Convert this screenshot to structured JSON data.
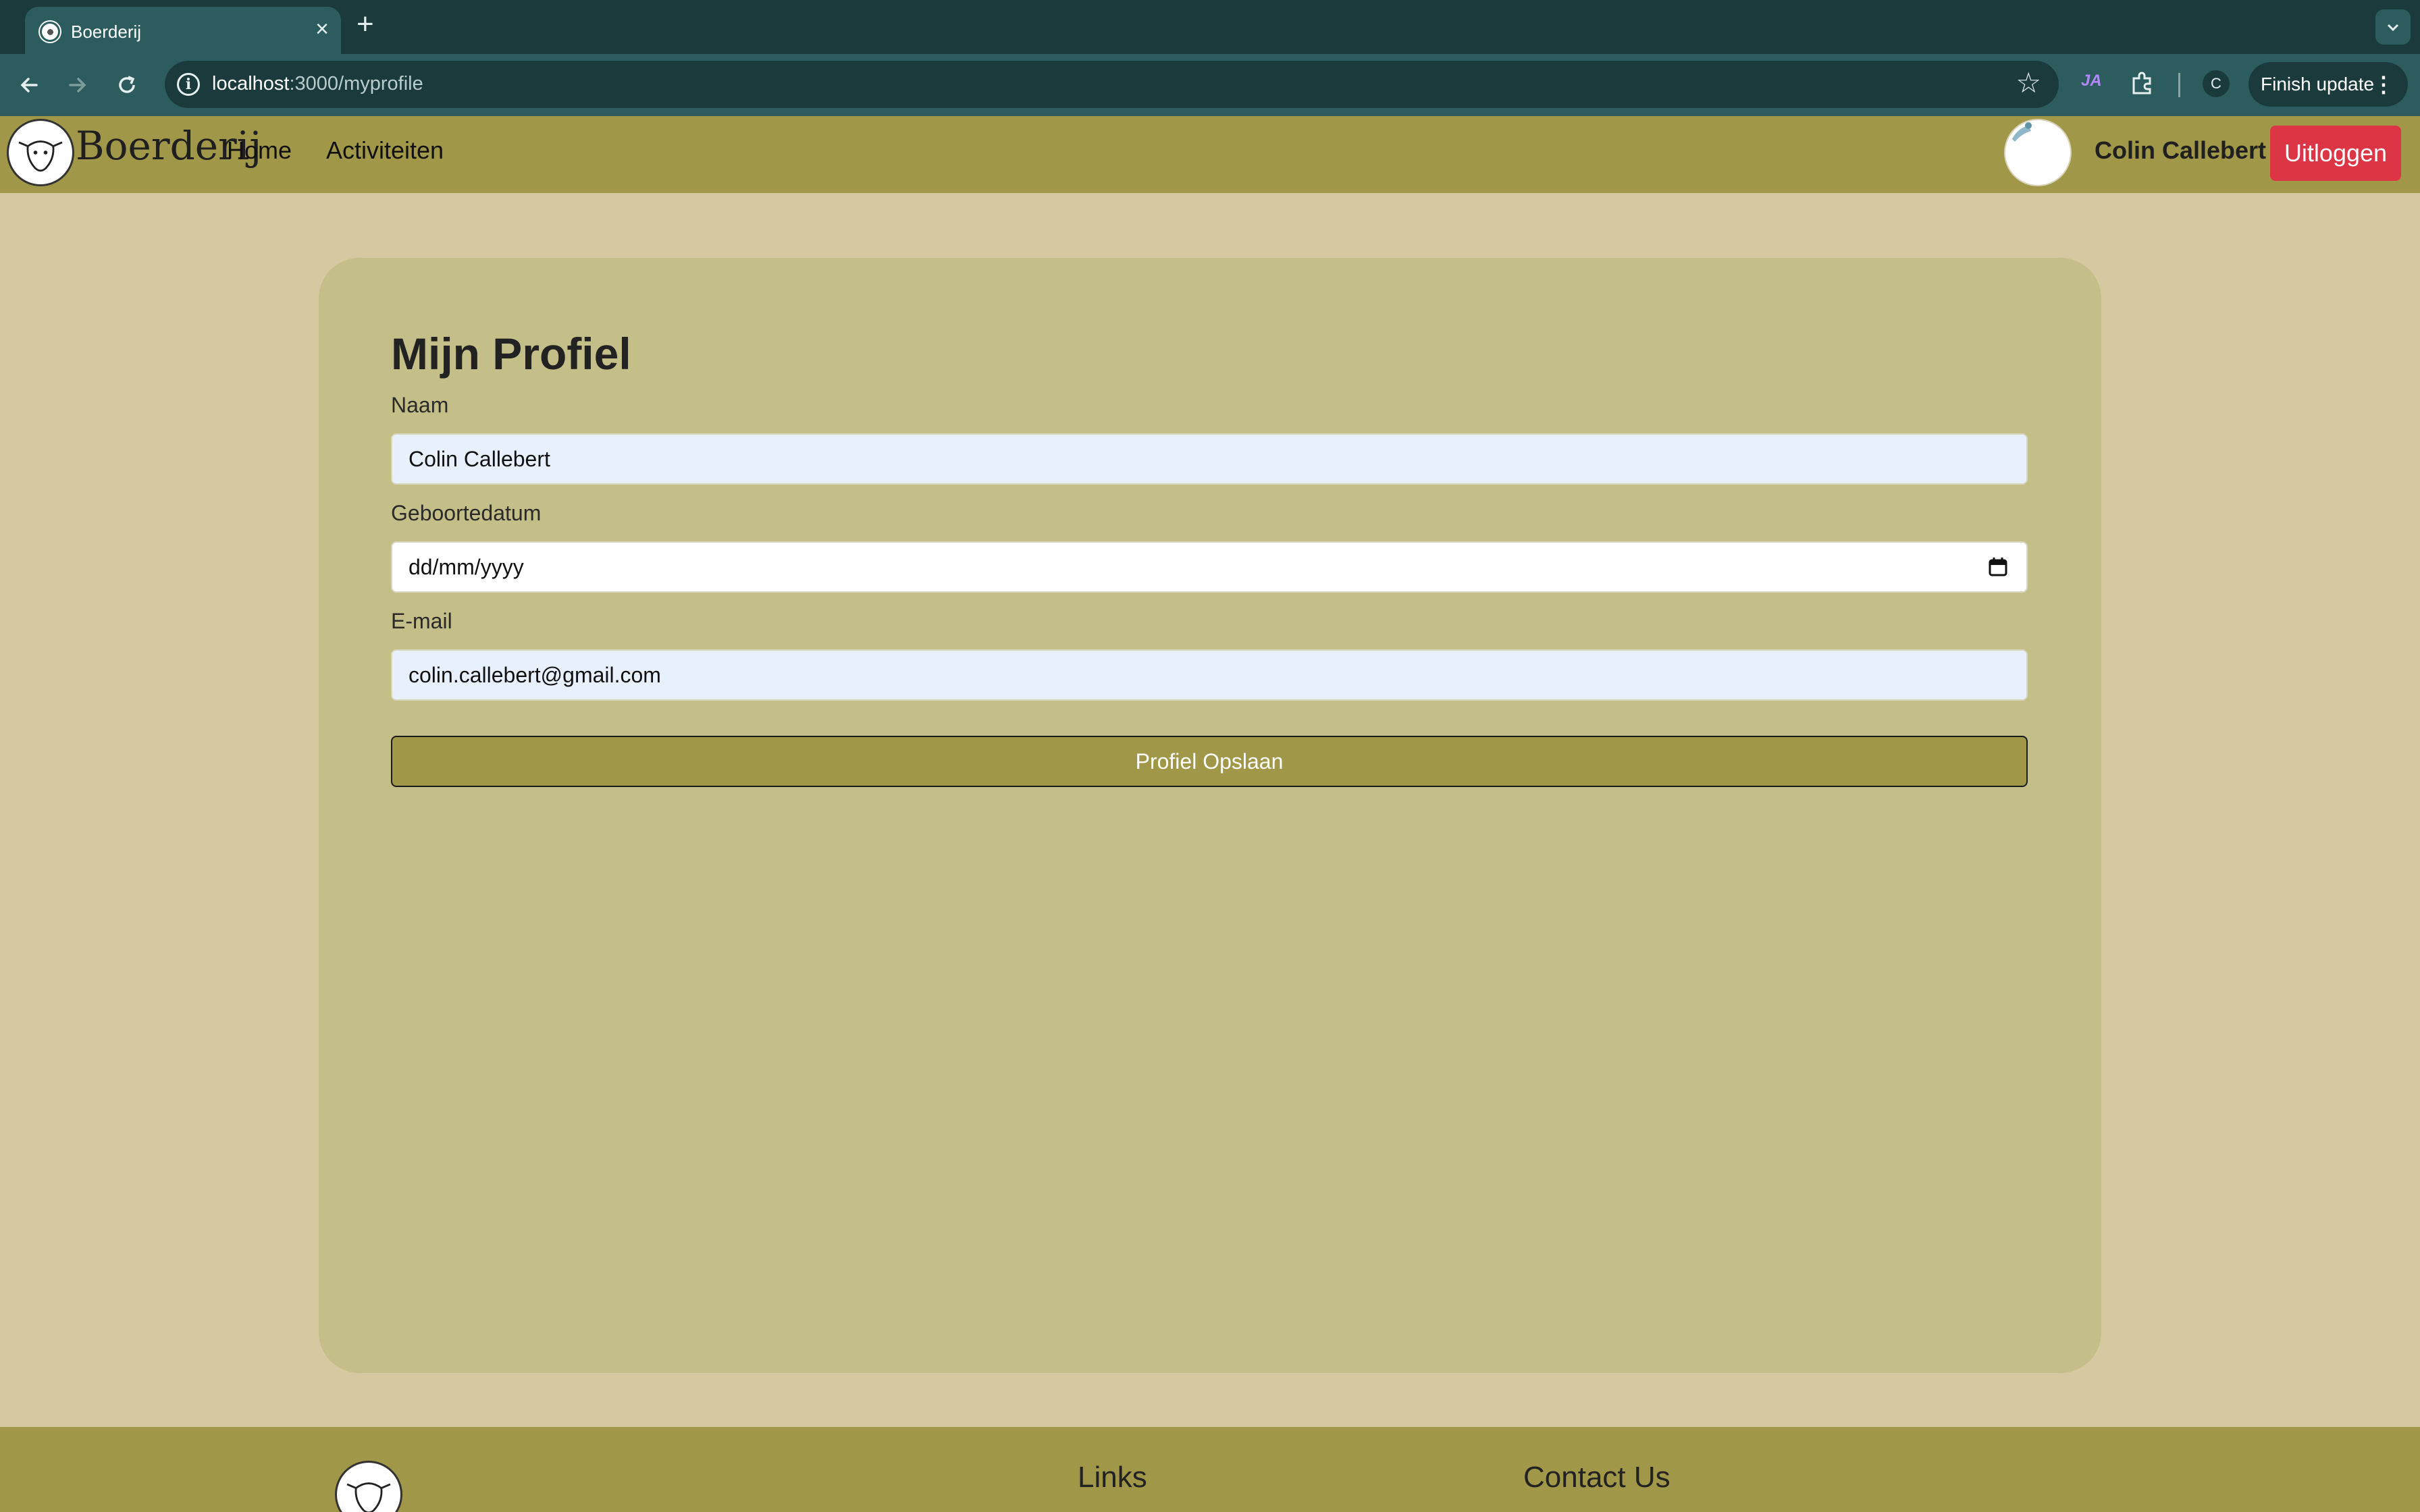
{
  "browser": {
    "tab_title": "Boerderij",
    "url_host": "localhost",
    "url_path": ":3000/myprofile",
    "extension_label": "JA",
    "profile_initial": "C",
    "finish_update": "Finish update"
  },
  "navbar": {
    "brand": "Boerderij",
    "links": [
      "Home",
      "Activiteiten"
    ],
    "user_name": "Colin Callebert",
    "logout": "Uitloggen"
  },
  "profile": {
    "title": "Mijn Profiel",
    "name_label": "Naam",
    "name_value": "Colin Callebert",
    "birth_label": "Geboortedatum",
    "birth_placeholder": "dd/mm/yyyy",
    "email_label": "E-mail",
    "email_value": "colin.callebert@gmail.com",
    "save_label": "Profiel Opslaan"
  },
  "footer": {
    "links_heading": "Links",
    "contact_heading": "Contact Us"
  },
  "colors": {
    "page_bg": "#d4c9a0",
    "navbar_bg": "#a19748",
    "card_bg": "#c4bf88",
    "logout_bg": "#dc3545",
    "browser_dark": "#1b3a3c",
    "browser_tab": "#2c5c5d"
  }
}
